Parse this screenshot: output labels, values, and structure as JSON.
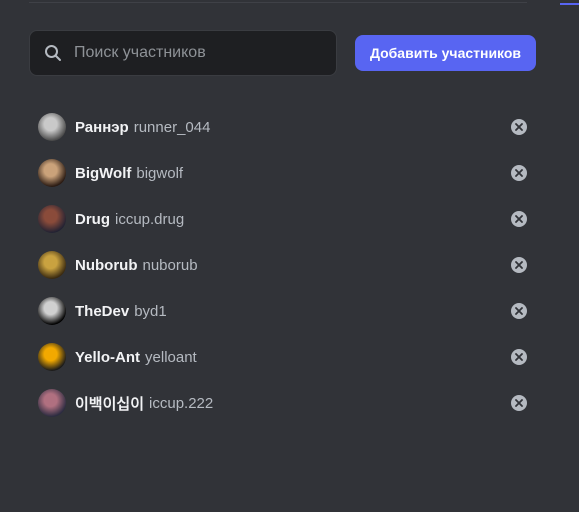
{
  "search": {
    "placeholder": "Поиск участников",
    "value": ""
  },
  "add_button": {
    "label": "Добавить участников"
  },
  "members": [
    {
      "display_name": "Раннэр",
      "username": "runner_044",
      "avatar_colors": [
        "#c9c9c9",
        "#4a4a4a"
      ]
    },
    {
      "display_name": "BigWolf",
      "username": "bigwolf",
      "avatar_colors": [
        "#caa27a",
        "#2a1a12"
      ]
    },
    {
      "display_name": "Drug",
      "username": "iccup.drug",
      "avatar_colors": [
        "#8a4b3a",
        "#222233"
      ]
    },
    {
      "display_name": "Nuborub",
      "username": "nuborub",
      "avatar_colors": [
        "#c9a240",
        "#3a2a10"
      ]
    },
    {
      "display_name": "TheDev",
      "username": "byd1",
      "avatar_colors": [
        "#d0d0d0",
        "#000000"
      ]
    },
    {
      "display_name": "Yello-Ant",
      "username": "yelloant",
      "avatar_colors": [
        "#f2a900",
        "#1a1a1a"
      ]
    },
    {
      "display_name": "이백이십이",
      "username": "iccup.222",
      "avatar_colors": [
        "#b07080",
        "#2b2b40"
      ]
    }
  ],
  "icons": {
    "search": "search-icon",
    "remove": "close-circle-icon"
  },
  "colors": {
    "accent": "#5865f2",
    "background": "#313338",
    "input_bg": "#1e1f22"
  }
}
